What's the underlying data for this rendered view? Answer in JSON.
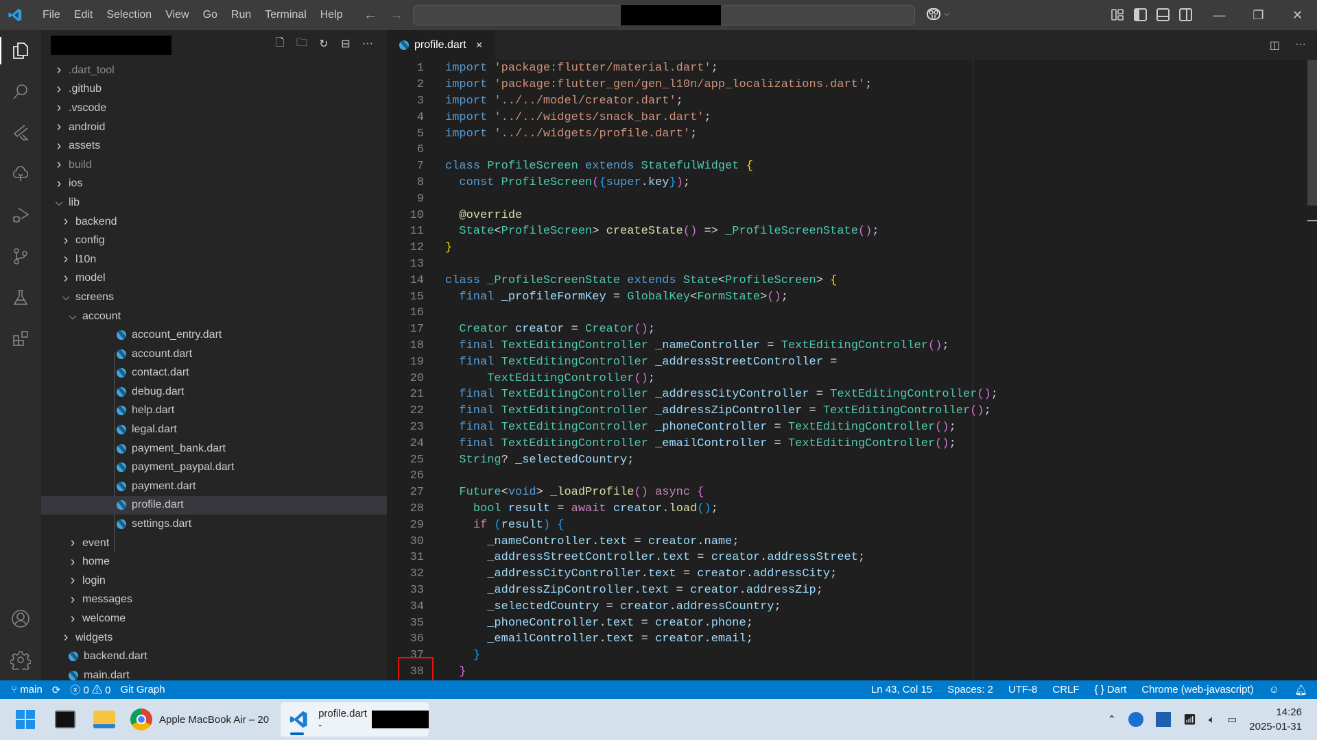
{
  "titlebar": {
    "menu": [
      "File",
      "Edit",
      "Selection",
      "View",
      "Go",
      "Run",
      "Terminal",
      "Help"
    ],
    "back_icon": "arrow-left-icon",
    "forward_icon": "arrow-right-icon"
  },
  "activity_bar": {
    "items": [
      "explorer",
      "search",
      "flutter",
      "testing-tree",
      "run-debug",
      "source-control",
      "testing",
      "extensions"
    ],
    "bottom": [
      "accounts",
      "manage"
    ]
  },
  "explorer": {
    "actions": [
      "new-file",
      "new-folder",
      "refresh",
      "collapse-all",
      "more"
    ],
    "tree": [
      {
        "label": ".dart_tool",
        "type": "folder",
        "depth": 0,
        "open": false,
        "dim": true
      },
      {
        "label": ".github",
        "type": "folder",
        "depth": 0,
        "open": false
      },
      {
        "label": ".vscode",
        "type": "folder",
        "depth": 0,
        "open": false
      },
      {
        "label": "android",
        "type": "folder",
        "depth": 0,
        "open": false
      },
      {
        "label": "assets",
        "type": "folder",
        "depth": 0,
        "open": false
      },
      {
        "label": "build",
        "type": "folder",
        "depth": 0,
        "open": false,
        "dim": true
      },
      {
        "label": "ios",
        "type": "folder",
        "depth": 0,
        "open": false
      },
      {
        "label": "lib",
        "type": "folder",
        "depth": 0,
        "open": true
      },
      {
        "label": "backend",
        "type": "folder",
        "depth": 1,
        "open": false
      },
      {
        "label": "config",
        "type": "folder",
        "depth": 1,
        "open": false
      },
      {
        "label": "l10n",
        "type": "folder",
        "depth": 1,
        "open": false
      },
      {
        "label": "model",
        "type": "folder",
        "depth": 1,
        "open": false
      },
      {
        "label": "screens",
        "type": "folder",
        "depth": 1,
        "open": true
      },
      {
        "label": "account",
        "type": "folder",
        "depth": 2,
        "open": true
      },
      {
        "label": "account_entry.dart",
        "type": "file",
        "depth": 3
      },
      {
        "label": "account.dart",
        "type": "file",
        "depth": 3
      },
      {
        "label": "contact.dart",
        "type": "file",
        "depth": 3
      },
      {
        "label": "debug.dart",
        "type": "file",
        "depth": 3
      },
      {
        "label": "help.dart",
        "type": "file",
        "depth": 3
      },
      {
        "label": "legal.dart",
        "type": "file",
        "depth": 3
      },
      {
        "label": "payment_bank.dart",
        "type": "file",
        "depth": 3
      },
      {
        "label": "payment_paypal.dart",
        "type": "file",
        "depth": 3
      },
      {
        "label": "payment.dart",
        "type": "file",
        "depth": 3
      },
      {
        "label": "profile.dart",
        "type": "file",
        "depth": 3,
        "selected": true
      },
      {
        "label": "settings.dart",
        "type": "file",
        "depth": 3
      },
      {
        "label": "event",
        "type": "folder",
        "depth": 2,
        "open": false
      },
      {
        "label": "home",
        "type": "folder",
        "depth": 2,
        "open": false
      },
      {
        "label": "login",
        "type": "folder",
        "depth": 2,
        "open": false
      },
      {
        "label": "messages",
        "type": "folder",
        "depth": 2,
        "open": false
      },
      {
        "label": "welcome",
        "type": "folder",
        "depth": 2,
        "open": false
      },
      {
        "label": "widgets",
        "type": "folder",
        "depth": 1,
        "open": false
      },
      {
        "label": "backend.dart",
        "type": "file",
        "depth": 1
      },
      {
        "label": "main.dart",
        "type": "file",
        "depth": 1
      }
    ]
  },
  "editor": {
    "tab": {
      "label": "profile.dart",
      "close": "×"
    },
    "lines": [
      [
        [
          "kw",
          "import"
        ],
        [
          "pn",
          " "
        ],
        [
          "str",
          "'package:flutter/material.dart'"
        ],
        [
          "pn",
          ";"
        ]
      ],
      [
        [
          "kw",
          "import"
        ],
        [
          "pn",
          " "
        ],
        [
          "str",
          "'package:flutter_gen/gen_l10n/app_localizations.dart'"
        ],
        [
          "pn",
          ";"
        ]
      ],
      [
        [
          "kw",
          "import"
        ],
        [
          "pn",
          " "
        ],
        [
          "str",
          "'../../model/creator.dart'"
        ],
        [
          "pn",
          ";"
        ]
      ],
      [
        [
          "kw",
          "import"
        ],
        [
          "pn",
          " "
        ],
        [
          "str",
          "'../../widgets/snack_bar.dart'"
        ],
        [
          "pn",
          ";"
        ]
      ],
      [
        [
          "kw",
          "import"
        ],
        [
          "pn",
          " "
        ],
        [
          "str",
          "'../../widgets/profile.dart'"
        ],
        [
          "pn",
          ";"
        ]
      ],
      [],
      [
        [
          "kw",
          "class"
        ],
        [
          "pn",
          " "
        ],
        [
          "cls",
          "ProfileScreen"
        ],
        [
          "pn",
          " "
        ],
        [
          "kw",
          "extends"
        ],
        [
          "pn",
          " "
        ],
        [
          "cls",
          "StatefulWidget"
        ],
        [
          "pn",
          " "
        ],
        [
          "br1",
          "{"
        ]
      ],
      [
        [
          "pn",
          "  "
        ],
        [
          "kw",
          "const"
        ],
        [
          "pn",
          " "
        ],
        [
          "cls",
          "ProfileScreen"
        ],
        [
          "br2",
          "("
        ],
        [
          "br3",
          "{"
        ],
        [
          "kw",
          "super"
        ],
        [
          "pn",
          "."
        ],
        [
          "var",
          "key"
        ],
        [
          "br3",
          "}"
        ],
        [
          "br2",
          ")"
        ],
        [
          "pn",
          ";"
        ]
      ],
      [],
      [
        [
          "pn",
          "  "
        ],
        [
          "ann",
          "@override"
        ]
      ],
      [
        [
          "pn",
          "  "
        ],
        [
          "cls",
          "State"
        ],
        [
          "pn",
          "<"
        ],
        [
          "cls",
          "ProfileScreen"
        ],
        [
          "pn",
          "> "
        ],
        [
          "fn",
          "createState"
        ],
        [
          "br2",
          "()"
        ],
        [
          "pn",
          " => "
        ],
        [
          "cls",
          "_ProfileScreenState"
        ],
        [
          "br2",
          "()"
        ],
        [
          "pn",
          ";"
        ]
      ],
      [
        [
          "br1",
          "}"
        ]
      ],
      [],
      [
        [
          "kw",
          "class"
        ],
        [
          "pn",
          " "
        ],
        [
          "cls",
          "_ProfileScreenState"
        ],
        [
          "pn",
          " "
        ],
        [
          "kw",
          "extends"
        ],
        [
          "pn",
          " "
        ],
        [
          "cls",
          "State"
        ],
        [
          "pn",
          "<"
        ],
        [
          "cls",
          "ProfileScreen"
        ],
        [
          "pn",
          "> "
        ],
        [
          "br1",
          "{"
        ]
      ],
      [
        [
          "pn",
          "  "
        ],
        [
          "kw",
          "final"
        ],
        [
          "pn",
          " "
        ],
        [
          "var",
          "_profileFormKey"
        ],
        [
          "pn",
          " = "
        ],
        [
          "cls",
          "GlobalKey"
        ],
        [
          "pn",
          "<"
        ],
        [
          "cls",
          "FormState"
        ],
        [
          "pn",
          ">"
        ],
        [
          "br2",
          "()"
        ],
        [
          "pn",
          ";"
        ]
      ],
      [],
      [
        [
          "pn",
          "  "
        ],
        [
          "cls",
          "Creator"
        ],
        [
          "pn",
          " "
        ],
        [
          "var",
          "creator"
        ],
        [
          "pn",
          " = "
        ],
        [
          "cls",
          "Creator"
        ],
        [
          "br2",
          "()"
        ],
        [
          "pn",
          ";"
        ]
      ],
      [
        [
          "pn",
          "  "
        ],
        [
          "kw",
          "final"
        ],
        [
          "pn",
          " "
        ],
        [
          "cls",
          "TextEditingController"
        ],
        [
          "pn",
          " "
        ],
        [
          "var",
          "_nameController"
        ],
        [
          "pn",
          " = "
        ],
        [
          "cls",
          "TextEditingController"
        ],
        [
          "br2",
          "()"
        ],
        [
          "pn",
          ";"
        ]
      ],
      [
        [
          "pn",
          "  "
        ],
        [
          "kw",
          "final"
        ],
        [
          "pn",
          " "
        ],
        [
          "cls",
          "TextEditingController"
        ],
        [
          "pn",
          " "
        ],
        [
          "var",
          "_addressStreetController"
        ],
        [
          "pn",
          " ="
        ]
      ],
      [
        [
          "pn",
          "      "
        ],
        [
          "cls",
          "TextEditingController"
        ],
        [
          "br2",
          "()"
        ],
        [
          "pn",
          ";"
        ]
      ],
      [
        [
          "pn",
          "  "
        ],
        [
          "kw",
          "final"
        ],
        [
          "pn",
          " "
        ],
        [
          "cls",
          "TextEditingController"
        ],
        [
          "pn",
          " "
        ],
        [
          "var",
          "_addressCityController"
        ],
        [
          "pn",
          " = "
        ],
        [
          "cls",
          "TextEditingController"
        ],
        [
          "br2",
          "()"
        ],
        [
          "pn",
          ";"
        ]
      ],
      [
        [
          "pn",
          "  "
        ],
        [
          "kw",
          "final"
        ],
        [
          "pn",
          " "
        ],
        [
          "cls",
          "TextEditingController"
        ],
        [
          "pn",
          " "
        ],
        [
          "var",
          "_addressZipController"
        ],
        [
          "pn",
          " = "
        ],
        [
          "cls",
          "TextEditingController"
        ],
        [
          "br2",
          "()"
        ],
        [
          "pn",
          ";"
        ]
      ],
      [
        [
          "pn",
          "  "
        ],
        [
          "kw",
          "final"
        ],
        [
          "pn",
          " "
        ],
        [
          "cls",
          "TextEditingController"
        ],
        [
          "pn",
          " "
        ],
        [
          "var",
          "_phoneController"
        ],
        [
          "pn",
          " = "
        ],
        [
          "cls",
          "TextEditingController"
        ],
        [
          "br2",
          "()"
        ],
        [
          "pn",
          ";"
        ]
      ],
      [
        [
          "pn",
          "  "
        ],
        [
          "kw",
          "final"
        ],
        [
          "pn",
          " "
        ],
        [
          "cls",
          "TextEditingController"
        ],
        [
          "pn",
          " "
        ],
        [
          "var",
          "_emailController"
        ],
        [
          "pn",
          " = "
        ],
        [
          "cls",
          "TextEditingController"
        ],
        [
          "br2",
          "()"
        ],
        [
          "pn",
          ";"
        ]
      ],
      [
        [
          "pn",
          "  "
        ],
        [
          "cls",
          "String"
        ],
        [
          "pn",
          "? "
        ],
        [
          "var",
          "_selectedCountry"
        ],
        [
          "pn",
          ";"
        ]
      ],
      [],
      [
        [
          "pn",
          "  "
        ],
        [
          "cls",
          "Future"
        ],
        [
          "pn",
          "<"
        ],
        [
          "kw",
          "void"
        ],
        [
          "pn",
          "> "
        ],
        [
          "fn",
          "_loadProfile"
        ],
        [
          "br2",
          "()"
        ],
        [
          "pn",
          " "
        ],
        [
          "ctl",
          "async"
        ],
        [
          "pn",
          " "
        ],
        [
          "br2",
          "{"
        ]
      ],
      [
        [
          "pn",
          "    "
        ],
        [
          "cls",
          "bool"
        ],
        [
          "pn",
          " "
        ],
        [
          "var",
          "result"
        ],
        [
          "pn",
          " = "
        ],
        [
          "ctl",
          "await"
        ],
        [
          "pn",
          " "
        ],
        [
          "var",
          "creator"
        ],
        [
          "pn",
          "."
        ],
        [
          "fn",
          "load"
        ],
        [
          "br3",
          "()"
        ],
        [
          "pn",
          ";"
        ]
      ],
      [
        [
          "pn",
          "    "
        ],
        [
          "ctl",
          "if"
        ],
        [
          "pn",
          " "
        ],
        [
          "br3",
          "("
        ],
        [
          "var",
          "result"
        ],
        [
          "br3",
          ")"
        ],
        [
          "pn",
          " "
        ],
        [
          "br3",
          "{"
        ]
      ],
      [
        [
          "pn",
          "      "
        ],
        [
          "var",
          "_nameController"
        ],
        [
          "pn",
          "."
        ],
        [
          "var",
          "text"
        ],
        [
          "pn",
          " = "
        ],
        [
          "var",
          "creator"
        ],
        [
          "pn",
          "."
        ],
        [
          "var",
          "name"
        ],
        [
          "pn",
          ";"
        ]
      ],
      [
        [
          "pn",
          "      "
        ],
        [
          "var",
          "_addressStreetController"
        ],
        [
          "pn",
          "."
        ],
        [
          "var",
          "text"
        ],
        [
          "pn",
          " = "
        ],
        [
          "var",
          "creator"
        ],
        [
          "pn",
          "."
        ],
        [
          "var",
          "addressStreet"
        ],
        [
          "pn",
          ";"
        ]
      ],
      [
        [
          "pn",
          "      "
        ],
        [
          "var",
          "_addressCityController"
        ],
        [
          "pn",
          "."
        ],
        [
          "var",
          "text"
        ],
        [
          "pn",
          " = "
        ],
        [
          "var",
          "creator"
        ],
        [
          "pn",
          "."
        ],
        [
          "var",
          "addressCity"
        ],
        [
          "pn",
          ";"
        ]
      ],
      [
        [
          "pn",
          "      "
        ],
        [
          "var",
          "_addressZipController"
        ],
        [
          "pn",
          "."
        ],
        [
          "var",
          "text"
        ],
        [
          "pn",
          " = "
        ],
        [
          "var",
          "creator"
        ],
        [
          "pn",
          "."
        ],
        [
          "var",
          "addressZip"
        ],
        [
          "pn",
          ";"
        ]
      ],
      [
        [
          "pn",
          "      "
        ],
        [
          "var",
          "_selectedCountry"
        ],
        [
          "pn",
          " = "
        ],
        [
          "var",
          "creator"
        ],
        [
          "pn",
          "."
        ],
        [
          "var",
          "addressCountry"
        ],
        [
          "pn",
          ";"
        ]
      ],
      [
        [
          "pn",
          "      "
        ],
        [
          "var",
          "_phoneController"
        ],
        [
          "pn",
          "."
        ],
        [
          "var",
          "text"
        ],
        [
          "pn",
          " = "
        ],
        [
          "var",
          "creator"
        ],
        [
          "pn",
          "."
        ],
        [
          "var",
          "phone"
        ],
        [
          "pn",
          ";"
        ]
      ],
      [
        [
          "pn",
          "      "
        ],
        [
          "var",
          "_emailController"
        ],
        [
          "pn",
          "."
        ],
        [
          "var",
          "text"
        ],
        [
          "pn",
          " = "
        ],
        [
          "var",
          "creator"
        ],
        [
          "pn",
          "."
        ],
        [
          "var",
          "email"
        ],
        [
          "pn",
          ";"
        ]
      ],
      [
        [
          "pn",
          "    "
        ],
        [
          "br3",
          "}"
        ]
      ],
      [
        [
          "pn",
          "  "
        ],
        [
          "br2",
          "}"
        ]
      ]
    ],
    "highlighted_line": 38
  },
  "statusbar": {
    "branch": "main",
    "errors": "0",
    "warnings": "0",
    "git_graph": "Git Graph",
    "position": "Ln 43, Col 15",
    "spaces": "Spaces: 2",
    "encoding": "UTF-8",
    "eol": "CRLF",
    "language": "Dart",
    "debug_target": "Chrome (web-javascript)"
  },
  "taskbar": {
    "chrome_label": "Apple MacBook Air – 20",
    "vscode_label": "profile.dart -",
    "time": "14:26",
    "date": "2025-01-31"
  },
  "colors": {
    "accent": "#007acc",
    "selection": "#37373d",
    "highlight_box": "#e51400"
  }
}
